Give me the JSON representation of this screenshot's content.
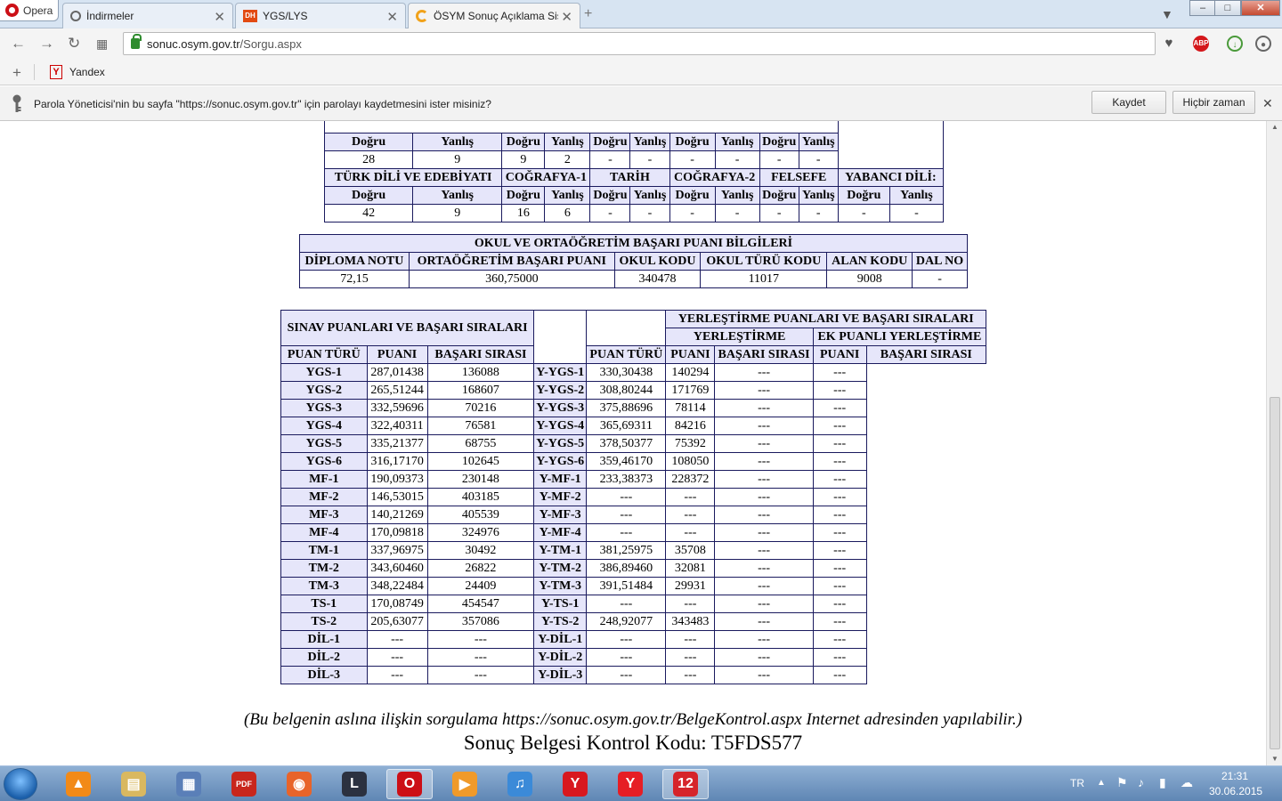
{
  "browser": {
    "opera_label": "Opera",
    "tabs": [
      {
        "title": "İndirmeler",
        "active": false
      },
      {
        "title": "YGS/LYS",
        "active": false
      },
      {
        "title": "ÖSYM Sonuç Açıklama Sis",
        "active": true
      }
    ],
    "window_controls": {
      "minimize": "–",
      "maximize": "□",
      "close": "✕"
    },
    "url_host": "sonuc.osym.gov.tr",
    "url_path": "/Sorgu.aspx",
    "bookmarks": {
      "add": "+",
      "yandex": "Yandex"
    },
    "password_bar": {
      "message": "Parola Yöneticisi'nin bu sayfa \"https://sonuc.osym.gov.tr\" için parolayı kaydetmesini ister misiniz?",
      "save_label": "Kaydet",
      "never_label": "Hiçbir zaman",
      "dismiss": "✕"
    }
  },
  "lys_results": {
    "row1_headers": [
      "Doğru",
      "Yanlış",
      "Doğru",
      "Yanlış",
      "Doğru",
      "Yanlış",
      "Doğru",
      "Yanlış",
      "Doğru",
      "Yanlış"
    ],
    "row1_values": [
      "28",
      "9",
      "9",
      "2",
      "-",
      "-",
      "-",
      "-",
      "-",
      "-"
    ],
    "subjects": [
      "TÜRK DİLİ VE EDEBİYATI",
      "COĞRAFYA-1",
      "TARİH",
      "COĞRAFYA-2",
      "FELSEFE",
      "YABANCI DİLİ:"
    ],
    "row2_headers": [
      "Doğru",
      "Yanlış",
      "Doğru",
      "Yanlış",
      "Doğru",
      "Yanlış",
      "Doğru",
      "Yanlış",
      "Doğru",
      "Yanlış",
      "Doğru",
      "Yanlış"
    ],
    "row2_values": [
      "42",
      "9",
      "16",
      "6",
      "-",
      "-",
      "-",
      "-",
      "-",
      "-",
      "-",
      "-"
    ]
  },
  "school": {
    "title": "OKUL VE ORTAÖĞRETİM BAŞARI PUANI BİLGİLERİ",
    "headers": [
      "DİPLOMA NOTU",
      "ORTAÖĞRETİM BAŞARI PUANI",
      "OKUL KODU",
      "OKUL TÜRÜ KODU",
      "ALAN KODU",
      "DAL NO"
    ],
    "values": [
      "72,15",
      "360,75000",
      "340478",
      "11017",
      "9008",
      "-"
    ]
  },
  "exam_scores": {
    "title": "SINAV PUANLARI VE BAŞARI SIRALARI",
    "headers": [
      "PUAN TÜRÜ",
      "PUANI",
      "BAŞARI SIRASI"
    ],
    "rows": [
      [
        "YGS-1",
        "287,01438",
        "136088"
      ],
      [
        "YGS-2",
        "265,51244",
        "168607"
      ],
      [
        "YGS-3",
        "332,59696",
        "70216"
      ],
      [
        "YGS-4",
        "322,40311",
        "76581"
      ],
      [
        "YGS-5",
        "335,21377",
        "68755"
      ],
      [
        "YGS-6",
        "316,17170",
        "102645"
      ],
      [
        "MF-1",
        "190,09373",
        "230148"
      ],
      [
        "MF-2",
        "146,53015",
        "403185"
      ],
      [
        "MF-3",
        "140,21269",
        "405539"
      ],
      [
        "MF-4",
        "170,09818",
        "324976"
      ],
      [
        "TM-1",
        "337,96975",
        "30492"
      ],
      [
        "TM-2",
        "343,60460",
        "26822"
      ],
      [
        "TM-3",
        "348,22484",
        "24409"
      ],
      [
        "TS-1",
        "170,08749",
        "454547"
      ],
      [
        "TS-2",
        "205,63077",
        "357086"
      ],
      [
        "DİL-1",
        "---",
        "---"
      ],
      [
        "DİL-2",
        "---",
        "---"
      ],
      [
        "DİL-3",
        "---",
        "---"
      ]
    ]
  },
  "placement_scores": {
    "title": "YERLEŞTİRME PUANLARI VE BAŞARI SIRALARI",
    "group1": "YERLEŞTİRME",
    "group2": "EK PUANLI YERLEŞTİRME",
    "headers": [
      "PUAN TÜRÜ",
      "PUANI",
      "BAŞARI SIRASI",
      "PUANI",
      "BAŞARI SIRASI"
    ],
    "rows": [
      [
        "Y-YGS-1",
        "330,30438",
        "140294",
        "---",
        "---"
      ],
      [
        "Y-YGS-2",
        "308,80244",
        "171769",
        "---",
        "---"
      ],
      [
        "Y-YGS-3",
        "375,88696",
        "78114",
        "---",
        "---"
      ],
      [
        "Y-YGS-4",
        "365,69311",
        "84216",
        "---",
        "---"
      ],
      [
        "Y-YGS-5",
        "378,50377",
        "75392",
        "---",
        "---"
      ],
      [
        "Y-YGS-6",
        "359,46170",
        "108050",
        "---",
        "---"
      ],
      [
        "Y-MF-1",
        "233,38373",
        "228372",
        "---",
        "---"
      ],
      [
        "Y-MF-2",
        "---",
        "---",
        "---",
        "---"
      ],
      [
        "Y-MF-3",
        "---",
        "---",
        "---",
        "---"
      ],
      [
        "Y-MF-4",
        "---",
        "---",
        "---",
        "---"
      ],
      [
        "Y-TM-1",
        "381,25975",
        "35708",
        "---",
        "---"
      ],
      [
        "Y-TM-2",
        "386,89460",
        "32081",
        "---",
        "---"
      ],
      [
        "Y-TM-3",
        "391,51484",
        "29931",
        "---",
        "---"
      ],
      [
        "Y-TS-1",
        "---",
        "---",
        "---",
        "---"
      ],
      [
        "Y-TS-2",
        "248,92077",
        "343483",
        "---",
        "---"
      ],
      [
        "Y-DİL-1",
        "---",
        "---",
        "---",
        "---"
      ],
      [
        "Y-DİL-2",
        "---",
        "---",
        "---",
        "---"
      ],
      [
        "Y-DİL-3",
        "---",
        "---",
        "---",
        "---"
      ]
    ]
  },
  "footer": {
    "note": "(Bu belgenin aslına ilişkin sorgulama https://sonuc.osym.gov.tr/BelgeKontrol.aspx Internet adresinden yapılabilir.)",
    "control_code": "Sonuç Belgesi Kontrol Kodu: T5FDS577"
  },
  "taskbar": {
    "lang": "TR",
    "time": "21:31",
    "date": "30.06.2015",
    "icons": [
      "vlc-icon",
      "explorer-icon",
      "network-icon",
      "pdf-icon",
      "firefox-icon",
      "league-icon",
      "opera-icon",
      "media-icon",
      "itunes-icon",
      "yandex-icon",
      "yandex-browser-icon",
      "channel12-icon"
    ]
  }
}
